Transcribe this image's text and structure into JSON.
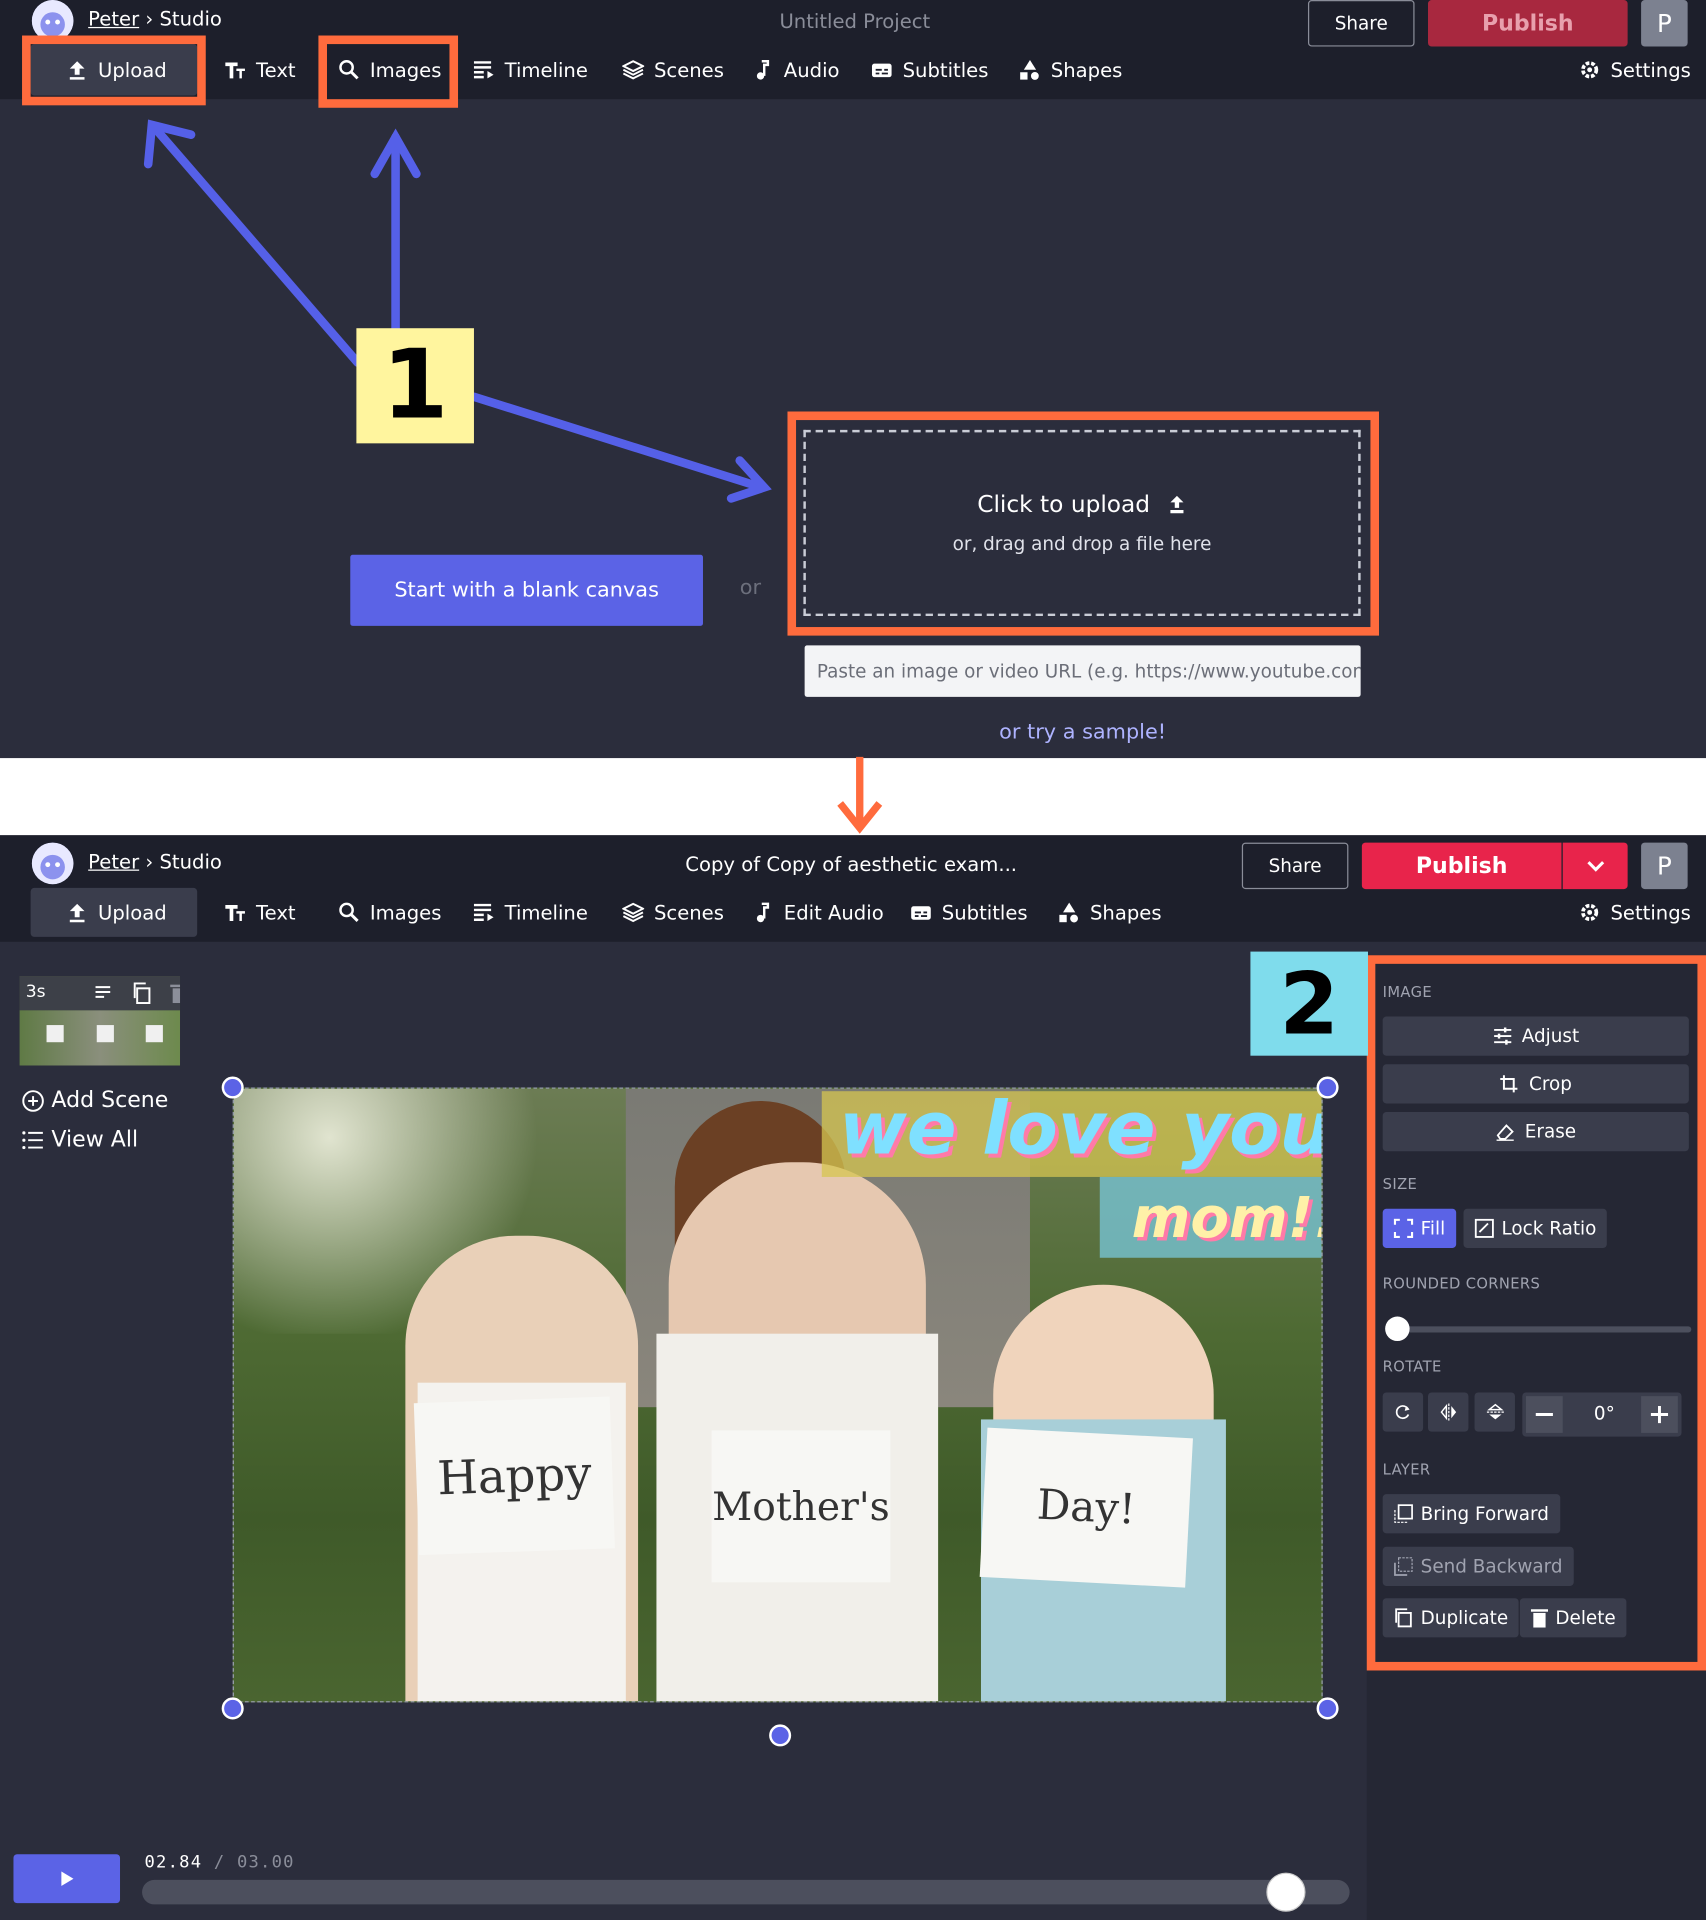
{
  "top": {
    "user_name": "Peter",
    "breadcrumb_sep": "›",
    "studio": "Studio",
    "project_title": "Untitled Project",
    "share": "Share",
    "publish": "Publish",
    "profile_initial": "P",
    "menu": [
      "Upload",
      "Text",
      "Images",
      "Timeline",
      "Scenes",
      "Audio",
      "Subtitles",
      "Shapes"
    ],
    "settings": "Settings",
    "step_number": "1",
    "blank_canvas": "Start with a blank canvas",
    "or": "or",
    "click_to_upload": "Click to upload",
    "drag_drop": "or, drag and drop a file here",
    "url_placeholder": "Paste an image or video URL (e.g. https://www.youtube.com/",
    "try_sample": "or try a sample!"
  },
  "bottom": {
    "user_name": "Peter",
    "breadcrumb_sep": "›",
    "studio": "Studio",
    "project_title": "Copy of Copy of aesthetic exam...",
    "share": "Share",
    "publish": "Publish",
    "profile_initial": "P",
    "menu": [
      "Upload",
      "Text",
      "Images",
      "Timeline",
      "Scenes",
      "Edit Audio",
      "Subtitles",
      "Shapes"
    ],
    "settings": "Settings",
    "scene_duration": "3s",
    "add_scene": "Add Scene",
    "view_all": "View All",
    "step_number": "2",
    "overlay_line1": "we love you",
    "overlay_line2": "mom!!",
    "signs": [
      "Happy",
      "Mother's",
      "Day!"
    ],
    "time_current": "02.84",
    "time_sep": "/",
    "time_total": "03.00",
    "playback_fraction": 0.947,
    "panel": {
      "image_label": "IMAGE",
      "adjust": "Adjust",
      "crop": "Crop",
      "erase": "Erase",
      "size_label": "SIZE",
      "fill": "Fill",
      "lock_ratio": "Lock Ratio",
      "rounded_label": "ROUNDED CORNERS",
      "rounded_fraction": 0.0,
      "rotate_label": "ROTATE",
      "rotate_value": "0°",
      "layer_label": "LAYER",
      "bring_forward": "Bring Forward",
      "send_backward": "Send Backward",
      "duplicate": "Duplicate",
      "delete": "Delete"
    }
  },
  "colors": {
    "orange": "#ff6b3d",
    "accent": "#5b63e6",
    "publish_top": "#a8283f",
    "publish_bottom": "#e8244b",
    "step1_bg": "#fff59e",
    "step2_bg": "#7fdcec"
  }
}
